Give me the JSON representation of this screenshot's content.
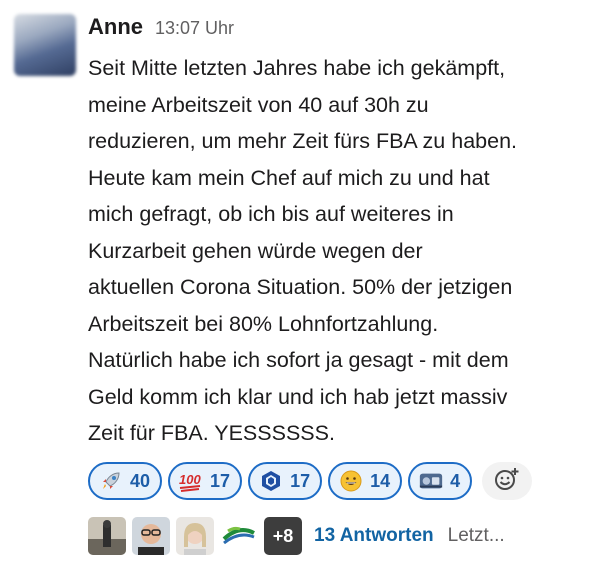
{
  "message": {
    "author": "Anne",
    "time": "13:07 Uhr",
    "text": "Seit Mitte letzten Jahres habe ich gekämpft,\nmeine Arbeitszeit von 40 auf 30h zu\nreduzieren, um mehr Zeit fürs FBA zu haben.\nHeute kam mein Chef auf mich zu und hat\nmich gefragt, ob ich bis auf weiteres in\nKurzarbeit  gehen würde wegen der\naktuellen Corona Situation. 50% der jetzigen\nArbeitszeit bei 80% Lohnfortzahlung.\nNatürlich habe ich sofort ja gesagt - mit dem\nGeld komm ich klar und ich hab jetzt massiv\nZeit für FBA. YESSSSSS."
  },
  "reactions": [
    {
      "icon": "rocket-icon",
      "count": "40"
    },
    {
      "icon": "hundred-points-icon",
      "count": "17"
    },
    {
      "icon": "hexagon-badge-icon",
      "count": "17"
    },
    {
      "icon": "grinning-face-icon",
      "count": "14"
    },
    {
      "icon": "custom-emoji-icon",
      "count": "4"
    }
  ],
  "add_reaction": {
    "icon": "add-reaction-icon"
  },
  "thread": {
    "more_count": "+8",
    "replies_label": "13 Antworten",
    "last_label": "Letzt..."
  },
  "colors": {
    "pill_border": "#1d6cc6",
    "pill_bg": "#e8f2fc",
    "link": "#1264a3"
  }
}
